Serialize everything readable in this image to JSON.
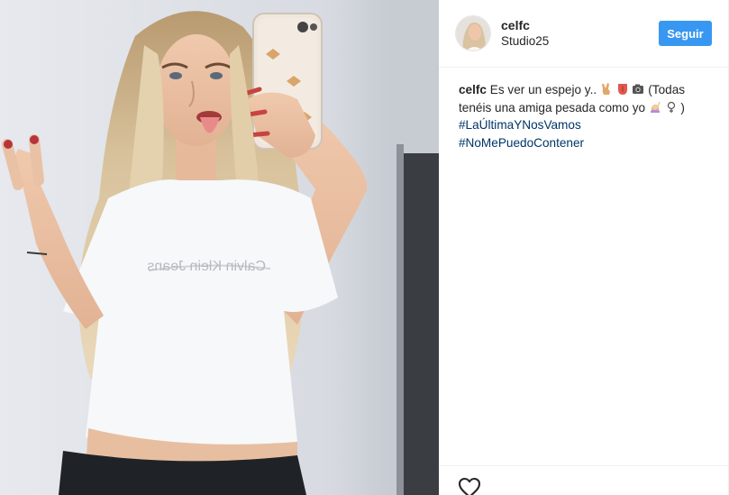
{
  "post": {
    "photo_alt": "",
    "colors": {
      "follow_button": "#3897f0",
      "hashtag": "#003569",
      "text": "#262626",
      "divider": "#efefef"
    }
  },
  "header": {
    "username": "celfc",
    "location": "Studio25",
    "follow_label": "Seguir"
  },
  "caption": {
    "username": "celfc",
    "text_part1": "Es ver un espejo y..",
    "text_part2": "(Todas tenéis una amiga pesada como yo",
    "text_part3": ")",
    "emojis": [
      "victory-hand",
      "tongue",
      "camera",
      "woman-raising-hand",
      "female-sign"
    ],
    "hashtags": [
      "#LaÚltimaYNosVamos",
      "#NoMePuedoContener"
    ]
  },
  "actions": {
    "icons": [
      "heart-icon"
    ]
  }
}
